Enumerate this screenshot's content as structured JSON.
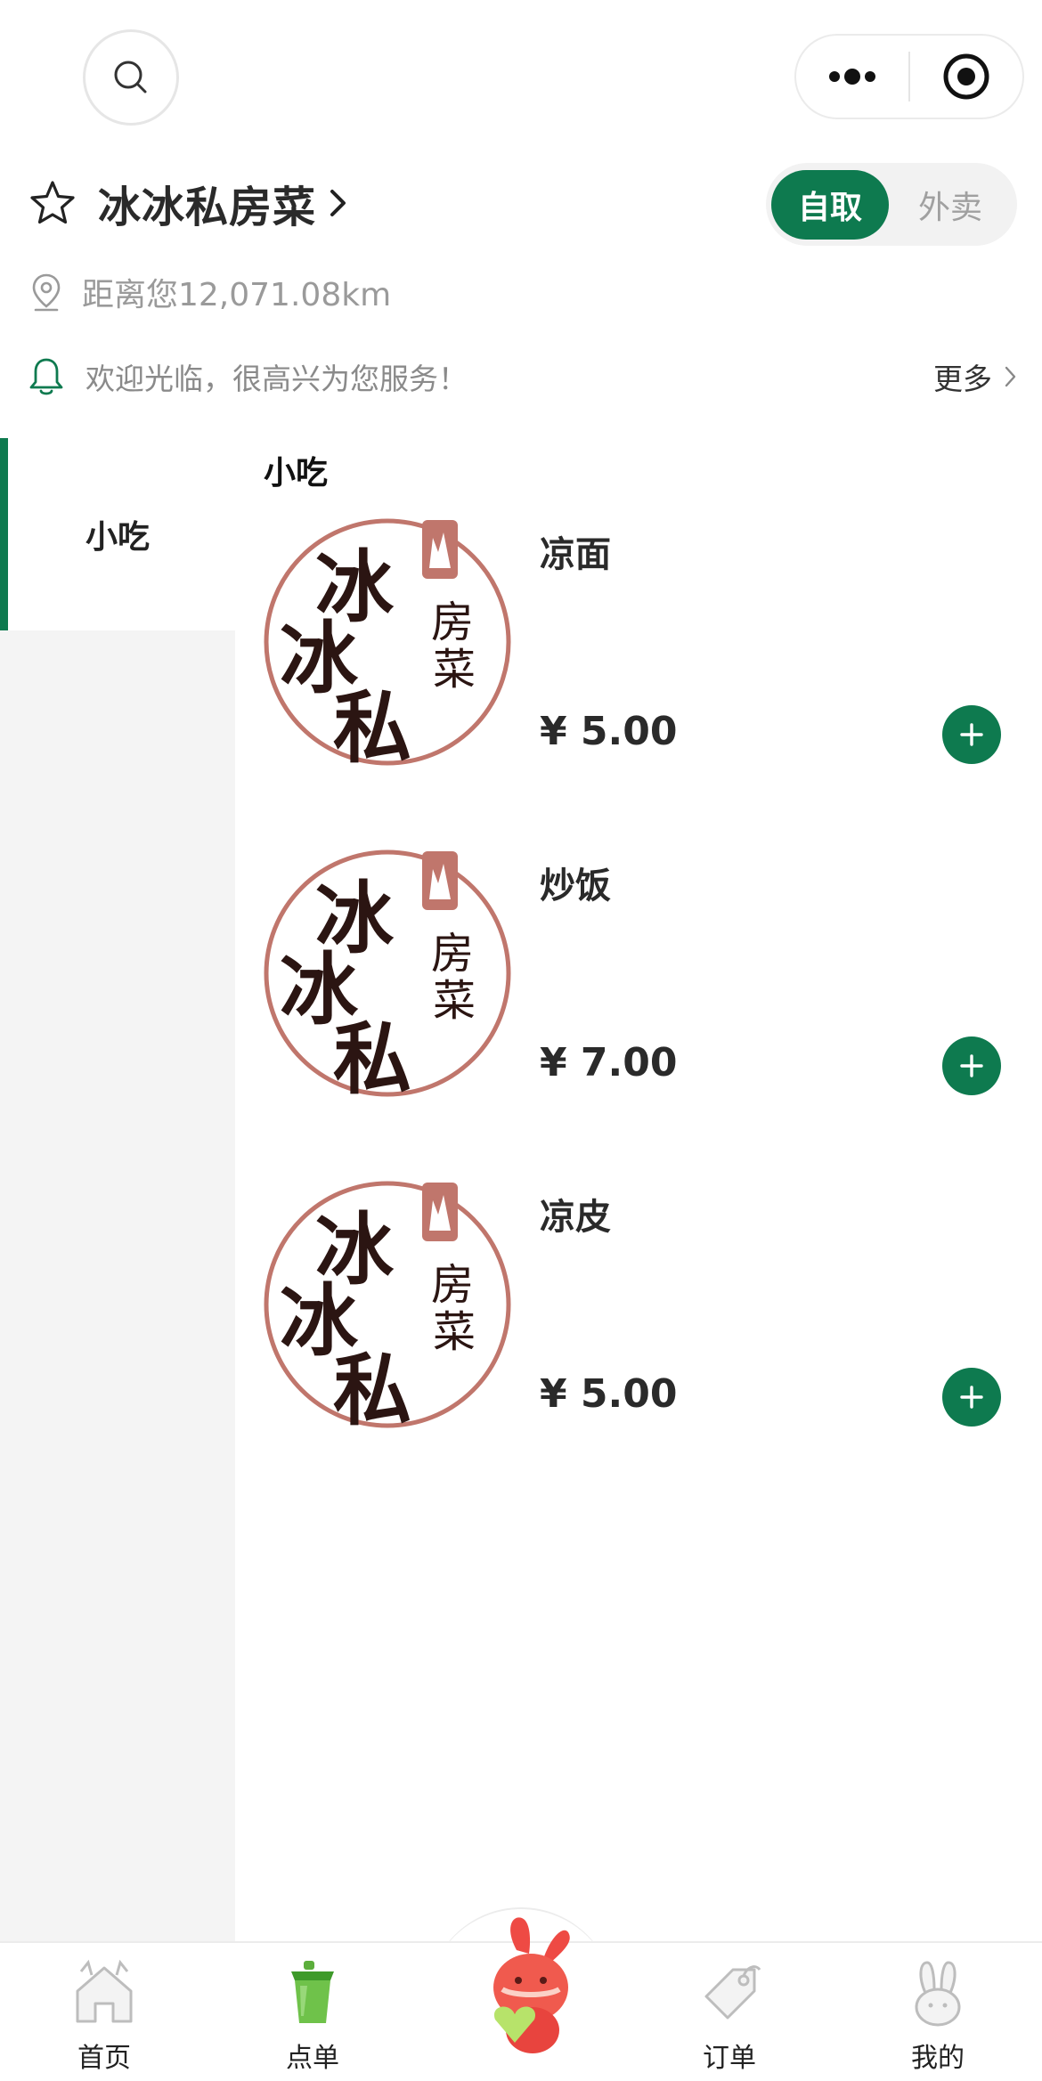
{
  "header": {
    "search_icon": "search-icon",
    "more_icon": "more-dots-icon",
    "close_icon": "target-close-icon"
  },
  "store": {
    "name": "冰冰私房菜",
    "distance": "距离您12,071.08km",
    "notice": "欢迎光临，很高兴为您服务！",
    "more_label": "更多",
    "mode_selected": "自取",
    "mode_other": "外卖"
  },
  "categories": [
    {
      "label": "小吃",
      "selected": true
    }
  ],
  "menu": {
    "section_title": "小吃",
    "items": [
      {
        "name": "凉面",
        "price": "¥ 5.00"
      },
      {
        "name": "炒饭",
        "price": "¥ 7.00"
      },
      {
        "name": "凉皮",
        "price": "¥ 5.00"
      }
    ]
  },
  "tabbar": {
    "items": [
      {
        "label": "首页",
        "icon": "home-icon"
      },
      {
        "label": "点单",
        "icon": "cup-icon"
      },
      {
        "label": "",
        "icon": "rabbit-mascot-icon"
      },
      {
        "label": "订单",
        "icon": "tag-icon"
      },
      {
        "label": "我的",
        "icon": "rabbit-icon"
      }
    ]
  },
  "colors": {
    "accent": "#0e7a4f",
    "logo_red": "#c0766c",
    "logo_ink": "#2b1512"
  }
}
